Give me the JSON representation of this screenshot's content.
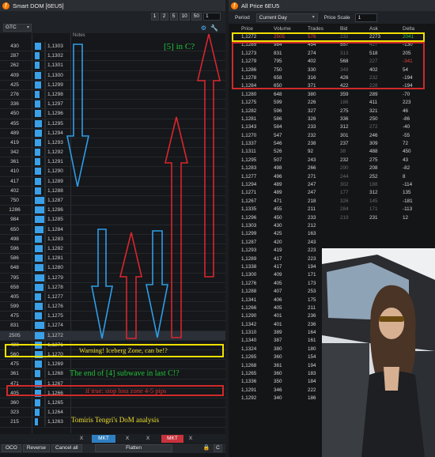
{
  "dom": {
    "title": "Smart DOM [6EU5]",
    "qty_buttons": [
      "1",
      "2",
      "5",
      "10",
      "50"
    ],
    "qty_value": "1",
    "tif": "GTC",
    "headers": {
      "notes": "Notes"
    },
    "rows": [
      {
        "vol": "430",
        "price": "1,1303",
        "bar": 8
      },
      {
        "vol": "287",
        "price": "1,1302",
        "bar": 6
      },
      {
        "vol": "262",
        "price": "1,1301",
        "bar": 6
      },
      {
        "vol": "409",
        "price": "1,1300",
        "bar": 8
      },
      {
        "vol": "425",
        "price": "1,1299",
        "bar": 8
      },
      {
        "vol": "276",
        "price": "1,1298",
        "bar": 6
      },
      {
        "vol": "336",
        "price": "1,1297",
        "bar": 7
      },
      {
        "vol": "450",
        "price": "1,1296",
        "bar": 8
      },
      {
        "vol": "455",
        "price": "1,1295",
        "bar": 9
      },
      {
        "vol": "489",
        "price": "1,1294",
        "bar": 9
      },
      {
        "vol": "419",
        "price": "1,1293",
        "bar": 8
      },
      {
        "vol": "342",
        "price": "1,1292",
        "bar": 7
      },
      {
        "vol": "361",
        "price": "1,1291",
        "bar": 7
      },
      {
        "vol": "410",
        "price": "1,1290",
        "bar": 8
      },
      {
        "vol": "417",
        "price": "1,1289",
        "bar": 8
      },
      {
        "vol": "402",
        "price": "1,1288",
        "bar": 8
      },
      {
        "vol": "750",
        "price": "1,1287",
        "bar": 12
      },
      {
        "vol": "1286",
        "price": "1,1286",
        "bar": 12
      },
      {
        "vol": "984",
        "price": "1,1285",
        "bar": 12
      },
      {
        "vol": "650",
        "price": "1,1284",
        "bar": 11
      },
      {
        "vol": "498",
        "price": "1,1283",
        "bar": 9
      },
      {
        "vol": "596",
        "price": "1,1282",
        "bar": 10
      },
      {
        "vol": "586",
        "price": "1,1281",
        "bar": 10
      },
      {
        "vol": "648",
        "price": "1,1280",
        "bar": 11
      },
      {
        "vol": "795",
        "price": "1,1279",
        "bar": 12
      },
      {
        "vol": "658",
        "price": "1,1278",
        "bar": 11
      },
      {
        "vol": "405",
        "price": "1,1277",
        "bar": 8
      },
      {
        "vol": "599",
        "price": "1,1276",
        "bar": 10
      },
      {
        "vol": "475",
        "price": "1,1275",
        "bar": 9
      },
      {
        "vol": "831",
        "price": "1,1274",
        "bar": 12
      },
      {
        "vol": "2505",
        "price": "1,1272",
        "bar": 14
      },
      {
        "vol": "490",
        "price": "1,1271",
        "bar": 9
      },
      {
        "vol": "560",
        "price": "1,1270",
        "bar": 10
      },
      {
        "vol": "475",
        "price": "1,1269",
        "bar": 9
      },
      {
        "vol": "361",
        "price": "1,1268",
        "bar": 7
      },
      {
        "vol": "471",
        "price": "1,1267",
        "bar": 9
      },
      {
        "vol": "405",
        "price": "1,1266",
        "bar": 8
      },
      {
        "vol": "360",
        "price": "1,1265",
        "bar": 7
      },
      {
        "vol": "323",
        "price": "1,1264",
        "bar": 6
      },
      {
        "vol": "215",
        "price": "1,1263",
        "bar": 4
      }
    ],
    "annotations": {
      "c5": "[5] in C?",
      "warning": "Warning! Iceberg  Zone, can be!?",
      "end_wave": "The end of [4] subwave in last C!?",
      "stoploss": "if true: stop loss zone 4-5 pips",
      "credit": "Tomiris Tengri's DoM analysis"
    },
    "bottom": {
      "mkt_buy": "MKT",
      "mkt_sell": "MKT",
      "x": "X"
    },
    "footer": {
      "oco": "OCO",
      "reverse": "Reverse",
      "cancel_all": "Cancel all",
      "flatten": "Flatten",
      "c": "C"
    }
  },
  "allprice": {
    "title": "All Price 6EU5",
    "period_label": "Period",
    "period_value": "Current Day",
    "scale_label": "Price Scale",
    "scale_value": "1",
    "headers": [
      "Price",
      "Volume",
      "Trades",
      "Bid",
      "Ask",
      "Delta"
    ],
    "rows": [
      [
        "1,1272",
        "2505",
        "576",
        "232",
        "2273",
        "2041"
      ],
      [
        "1,1285",
        "984",
        "454",
        "557",
        "427",
        "-130"
      ],
      [
        "1,1273",
        "831",
        "274",
        "313",
        "518",
        "205"
      ],
      [
        "1,1279",
        "795",
        "402",
        "568",
        "227",
        "-341"
      ],
      [
        "1,1286",
        "750",
        "330",
        "348",
        "402",
        "54"
      ],
      [
        "1,1278",
        "658",
        "316",
        "426",
        "232",
        "-194"
      ],
      [
        "1,1284",
        "650",
        "371",
        "422",
        "228",
        "-194"
      ],
      [
        "1,1280",
        "648",
        "380",
        "359",
        "289",
        "-70"
      ],
      [
        "1,1275",
        "599",
        "226",
        "186",
        "411",
        "223"
      ],
      [
        "1,1282",
        "596",
        "327",
        "275",
        "321",
        "46"
      ],
      [
        "1,1281",
        "586",
        "326",
        "336",
        "250",
        "-86"
      ],
      [
        "1,1343",
        "584",
        "233",
        "312",
        "272",
        "-40"
      ],
      [
        "1,1270",
        "547",
        "232",
        "301",
        "246",
        "-55"
      ],
      [
        "1,1337",
        "546",
        "238",
        "237",
        "309",
        "72"
      ],
      [
        "1,1311",
        "526",
        "92",
        "38",
        "488",
        "450"
      ],
      [
        "1,1295",
        "507",
        "243",
        "232",
        "275",
        "43"
      ],
      [
        "1,1283",
        "498",
        "266",
        "290",
        "208",
        "-82"
      ],
      [
        "1,1277",
        "496",
        "271",
        "244",
        "252",
        "8"
      ],
      [
        "1,1294",
        "489",
        "247",
        "302",
        "188",
        "-114"
      ],
      [
        "1,1271",
        "489",
        "247",
        "177",
        "312",
        "135"
      ],
      [
        "1,1267",
        "471",
        "218",
        "326",
        "145",
        "-181"
      ],
      [
        "1,1335",
        "455",
        "211",
        "284",
        "171",
        "-113"
      ],
      [
        "1,1296",
        "450",
        "233",
        "219",
        "231",
        "12"
      ],
      [
        "1,1303",
        "430",
        "212",
        "",
        "",
        ""
      ],
      [
        "1,1299",
        "425",
        "163",
        "",
        "",
        ""
      ],
      [
        "1,1287",
        "420",
        "243",
        "",
        "",
        ""
      ],
      [
        "1,1293",
        "419",
        "223",
        "",
        "",
        ""
      ],
      [
        "1,1289",
        "417",
        "223",
        "",
        "",
        ""
      ],
      [
        "1,1338",
        "417",
        "194",
        "",
        "",
        ""
      ],
      [
        "1,1300",
        "409",
        "171",
        "",
        "",
        ""
      ],
      [
        "1,1276",
        "405",
        "173",
        "",
        "",
        ""
      ],
      [
        "1,1288",
        "407",
        "253",
        "",
        "",
        ""
      ],
      [
        "1,1341",
        "406",
        "175",
        "",
        "",
        ""
      ],
      [
        "1,1266",
        "405",
        "211",
        "",
        "",
        ""
      ],
      [
        "1,1290",
        "401",
        "236",
        "",
        "",
        ""
      ],
      [
        "1,1342",
        "401",
        "236",
        "",
        "",
        ""
      ],
      [
        "1,1310",
        "389",
        "164",
        "",
        "",
        ""
      ],
      [
        "1,1340",
        "387",
        "161",
        "",
        "",
        ""
      ],
      [
        "1,1324",
        "380",
        "180",
        "",
        "",
        ""
      ],
      [
        "1,1265",
        "360",
        "154",
        "",
        "",
        ""
      ],
      [
        "1,1268",
        "361",
        "194",
        "",
        "",
        ""
      ],
      [
        "1,1265",
        "360",
        "183",
        "",
        "",
        ""
      ],
      [
        "1,1336",
        "350",
        "184",
        "",
        "",
        ""
      ],
      [
        "1,1291",
        "346",
        "222",
        "",
        "",
        ""
      ],
      [
        "1,1292",
        "340",
        "186",
        "",
        "",
        ""
      ]
    ],
    "colors": {
      "positive": "#2ec04a",
      "negative": "#e34040"
    }
  }
}
